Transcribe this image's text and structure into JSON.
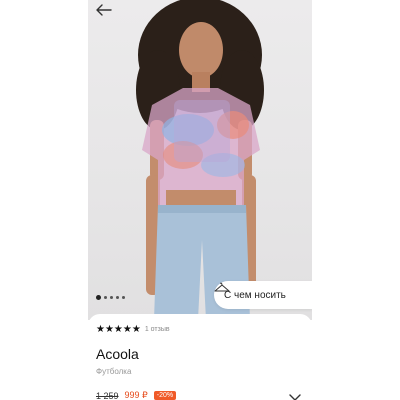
{
  "product": {
    "rating_stars": "★★★★★",
    "reviews_label": "1 отзыв",
    "brand": "Acoola",
    "category": "Футболка",
    "old_price": "1 259",
    "new_price": "999 ₽",
    "discount": "-20%"
  },
  "gallery": {
    "slide_count": 5,
    "active_slide": 1,
    "outfit_button_label": "С чем носить"
  },
  "icons": {
    "back": "arrow-left-icon",
    "hanger": "hanger-icon",
    "expand": "chevron-down-icon"
  },
  "colors": {
    "discount_badge": "#f05a28",
    "new_price": "#e64a19"
  }
}
